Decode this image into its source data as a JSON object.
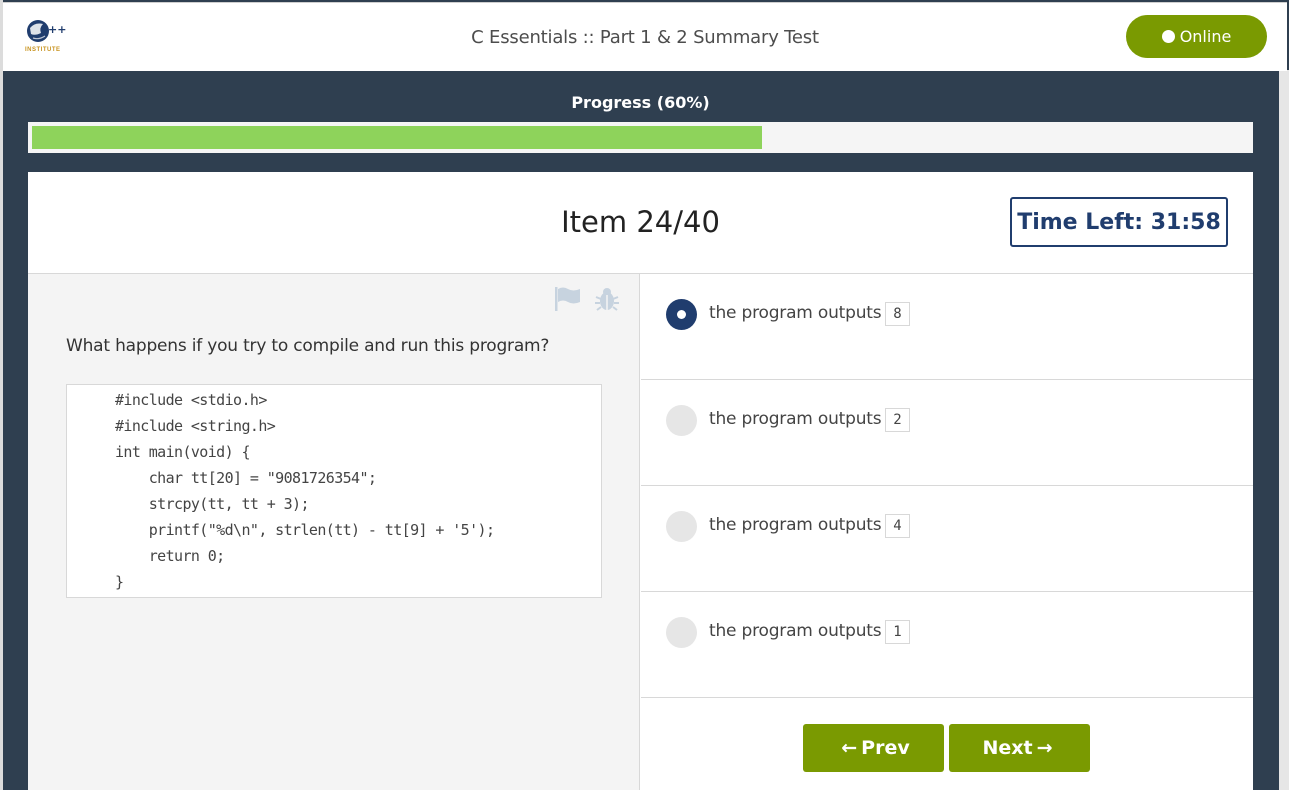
{
  "header": {
    "logo_text": "INSTITUTE",
    "logo_mark": "C++",
    "title": "C Essentials :: Part 1 & 2 Summary Test",
    "status_label": "Online"
  },
  "progress": {
    "label": "Progress (60%)",
    "percent": 60
  },
  "item": {
    "title": "Item 24/40",
    "time_left": "Time Left: 31:58"
  },
  "question": {
    "text": "What happens if you try to compile and run this program?",
    "code": [
      "#include <stdio.h>",
      "#include <string.h>",
      "int main(void) {",
      "    char tt[20] = \"9081726354\";",
      "    strcpy(tt, tt + 3);",
      "    printf(\"%d\\n\", strlen(tt) - tt[9] + '5');",
      "    return 0;",
      "}"
    ]
  },
  "answers": [
    {
      "text": "the program outputs",
      "code": "8",
      "selected": true
    },
    {
      "text": "the program outputs",
      "code": "2",
      "selected": false
    },
    {
      "text": "the program outputs",
      "code": "4",
      "selected": false
    },
    {
      "text": "the program outputs",
      "code": "1",
      "selected": false
    }
  ],
  "nav": {
    "prev_label": "Prev",
    "next_label": "Next"
  },
  "colors": {
    "accent_green": "#7a9a01",
    "progress_green": "#8ed35b",
    "navy": "#203d6e",
    "frame": "#2f3f50"
  },
  "icons": {
    "flag": "flag-icon",
    "bug": "bug-icon",
    "prev_arrow": "arrow-left-icon",
    "next_arrow": "arrow-right-icon"
  }
}
